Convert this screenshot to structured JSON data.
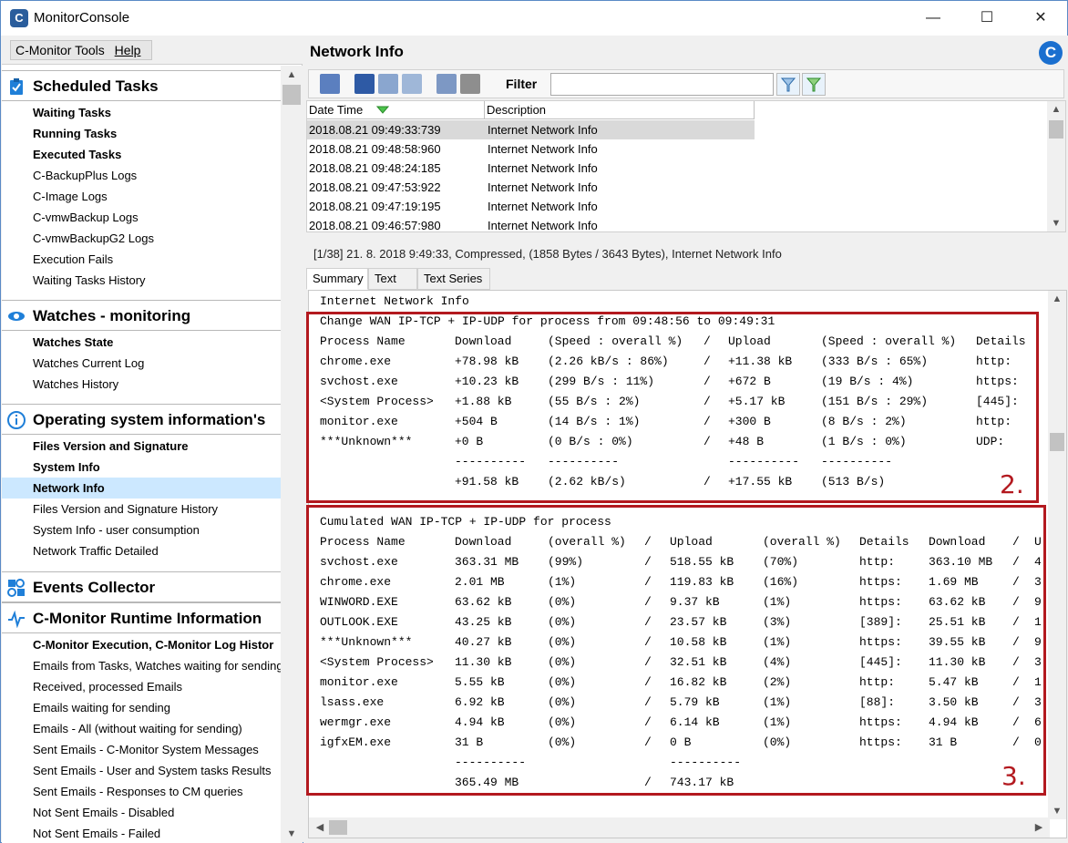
{
  "window": {
    "title": "MonitorConsole",
    "app_icon": "C",
    "controls": [
      "—",
      "☐",
      "✕"
    ]
  },
  "menu": [
    "C-Monitor Tools",
    "Help"
  ],
  "sections": [
    {
      "label": "Scheduled Tasks",
      "icon": "clipboard-check-icon",
      "items": [
        {
          "label": "Waiting Tasks",
          "bold": true
        },
        {
          "label": "Running Tasks",
          "bold": true
        },
        {
          "label": "Executed Tasks",
          "bold": true
        },
        {
          "label": "C-BackupPlus Logs"
        },
        {
          "label": "C-Image Logs"
        },
        {
          "label": "C-vmwBackup Logs"
        },
        {
          "label": "C-vmwBackupG2 Logs"
        },
        {
          "label": "Execution Fails"
        },
        {
          "label": "Waiting Tasks History"
        }
      ]
    },
    {
      "label": "Watches - monitoring",
      "icon": "eye-icon",
      "items": [
        {
          "label": "Watches State",
          "bold": true
        },
        {
          "label": "Watches Current Log"
        },
        {
          "label": "Watches History"
        }
      ]
    },
    {
      "label": "Operating system information's",
      "icon": "info-icon",
      "items": [
        {
          "label": "Files Version and Signature",
          "bold": true
        },
        {
          "label": "System Info",
          "bold": true
        },
        {
          "label": "Network Info",
          "bold": true,
          "selected": true
        },
        {
          "label": "Files Version and Signature History"
        },
        {
          "label": "System Info - user consumption"
        },
        {
          "label": "Network Traffic Detailed"
        }
      ]
    },
    {
      "label": "Events Collector",
      "icon": "network-icon",
      "items": []
    },
    {
      "label": "C-Monitor Runtime Information",
      "icon": "pulse-icon",
      "items": [
        {
          "label": "C-Monitor Execution, C-Monitor Log Histor",
          "bold": true
        },
        {
          "label": "Emails from Tasks, Watches waiting for sending"
        },
        {
          "label": "Received, processed Emails"
        },
        {
          "label": "Emails waiting for sending"
        },
        {
          "label": "Emails - All (without waiting for sending)"
        },
        {
          "label": "Sent Emails - C-Monitor System Messages"
        },
        {
          "label": "Sent Emails - User and System tasks Results"
        },
        {
          "label": "Sent Emails - Responses to CM queries"
        },
        {
          "label": "Not Sent Emails - Disabled"
        },
        {
          "label": "Not Sent Emails - Failed"
        }
      ]
    }
  ],
  "right": {
    "title": "Network Info",
    "logo": "C",
    "filter_label": "Filter",
    "filter_value": "",
    "grid": {
      "headers": [
        "Date Time",
        "Description"
      ],
      "rows": [
        [
          "2018.08.21   09:49:33:739",
          "Internet Network Info"
        ],
        [
          "2018.08.21   09:48:58:960",
          "Internet Network Info"
        ],
        [
          "2018.08.21   09:48:24:185",
          "Internet Network Info"
        ],
        [
          "2018.08.21   09:47:53:922",
          "Internet Network Info"
        ],
        [
          "2018.08.21   09:47:19:195",
          "Internet Network Info"
        ],
        [
          "2018.08.21   09:46:57:980",
          "Internet Network Info"
        ]
      ]
    },
    "status": "[1/38]   21. 8. 2018 9:49:33, Compressed, (1858 Bytes / 3643 Bytes), Internet Network Info",
    "tabs": [
      "Summary",
      "Text",
      "Text Series"
    ],
    "heading": "Internet Network Info",
    "change_title": "Change WAN IP-TCP + IP-UDP for process from 09:48:56 to 09:49:31",
    "change_header": [
      "Process Name",
      "Download",
      "(Speed : overall %)",
      "/",
      "Upload",
      "(Speed : overall %)",
      "Details"
    ],
    "change_rows": [
      [
        "chrome.exe",
        "+78.98 kB",
        "(2.26 kB/s : 86%)",
        "/",
        "+11.38 kB",
        "(333 B/s : 65%)",
        "http:"
      ],
      [
        "svchost.exe",
        "+10.23 kB",
        "(299 B/s : 11%)",
        "/",
        "+672 B",
        "(19 B/s : 4%)",
        "https:"
      ],
      [
        "<System Process>",
        "+1.88 kB",
        "(55 B/s : 2%)",
        "/",
        "+5.17 kB",
        "(151 B/s : 29%)",
        "[445]:"
      ],
      [
        "monitor.exe",
        "+504 B",
        "(14 B/s : 1%)",
        "/",
        "+300 B",
        "(8 B/s : 2%)",
        "http:"
      ],
      [
        "***Unknown***",
        "+0 B",
        "(0 B/s : 0%)",
        "/",
        "+48 B",
        "(1 B/s : 0%)",
        "UDP:"
      ]
    ],
    "change_sep": [
      "",
      "----------",
      "----------",
      "",
      "----------",
      "----------",
      ""
    ],
    "change_total": [
      "",
      "+91.58 kB",
      "(2.62 kB/s)",
      "/",
      "+17.55 kB",
      "(513 B/s)",
      ""
    ],
    "cum_title": "Cumulated WAN IP-TCP + IP-UDP for process",
    "cum_header": [
      "Process Name",
      "Download",
      "(overall %)",
      "/",
      "Upload",
      "(overall %)",
      "Details",
      "Download",
      "/",
      "U"
    ],
    "cum_rows": [
      [
        "svchost.exe",
        "363.31 MB",
        "(99%)",
        "/",
        "518.55 kB",
        "(70%)",
        "http:",
        "363.10 MB",
        "/",
        "4"
      ],
      [
        "chrome.exe",
        "2.01 MB",
        "(1%)",
        "/",
        "119.83 kB",
        "(16%)",
        "https:",
        "1.69 MB",
        "/",
        "3"
      ],
      [
        "WINWORD.EXE",
        "63.62 kB",
        "(0%)",
        "/",
        "9.37 kB",
        "(1%)",
        "https:",
        "63.62 kB",
        "/",
        "9"
      ],
      [
        "OUTLOOK.EXE",
        "43.25 kB",
        "(0%)",
        "/",
        "23.57 kB",
        "(3%)",
        "[389]:",
        "25.51 kB",
        "/",
        "1"
      ],
      [
        "***Unknown***",
        "40.27 kB",
        "(0%)",
        "/",
        "10.58 kB",
        "(1%)",
        "https:",
        "39.55 kB",
        "/",
        "9"
      ],
      [
        "<System Process>",
        "11.30 kB",
        "(0%)",
        "/",
        "32.51 kB",
        "(4%)",
        "[445]:",
        "11.30 kB",
        "/",
        "3"
      ],
      [
        "monitor.exe",
        "5.55 kB",
        "(0%)",
        "/",
        "16.82 kB",
        "(2%)",
        "http:",
        "5.47 kB",
        "/",
        "1"
      ],
      [
        "lsass.exe",
        "6.92 kB",
        "(0%)",
        "/",
        "5.79 kB",
        "(1%)",
        "[88]:",
        "3.50 kB",
        "/",
        "3"
      ],
      [
        "wermgr.exe",
        "4.94 kB",
        "(0%)",
        "/",
        "6.14 kB",
        "(1%)",
        "https:",
        "4.94 kB",
        "/",
        "6"
      ],
      [
        "igfxEM.exe",
        "31 B",
        "(0%)",
        "/",
        "0 B",
        "(0%)",
        "https:",
        "31 B",
        "/",
        "0"
      ]
    ],
    "cum_sep": [
      "",
      "----------",
      "",
      "",
      "----------",
      "",
      "",
      "",
      "",
      ""
    ],
    "cum_total": [
      "",
      "365.49 MB",
      "",
      "/",
      "743.17 kB",
      "",
      "",
      "",
      "",
      ""
    ],
    "annotations": [
      "2.",
      "3."
    ],
    "accent": "#b3191f"
  }
}
